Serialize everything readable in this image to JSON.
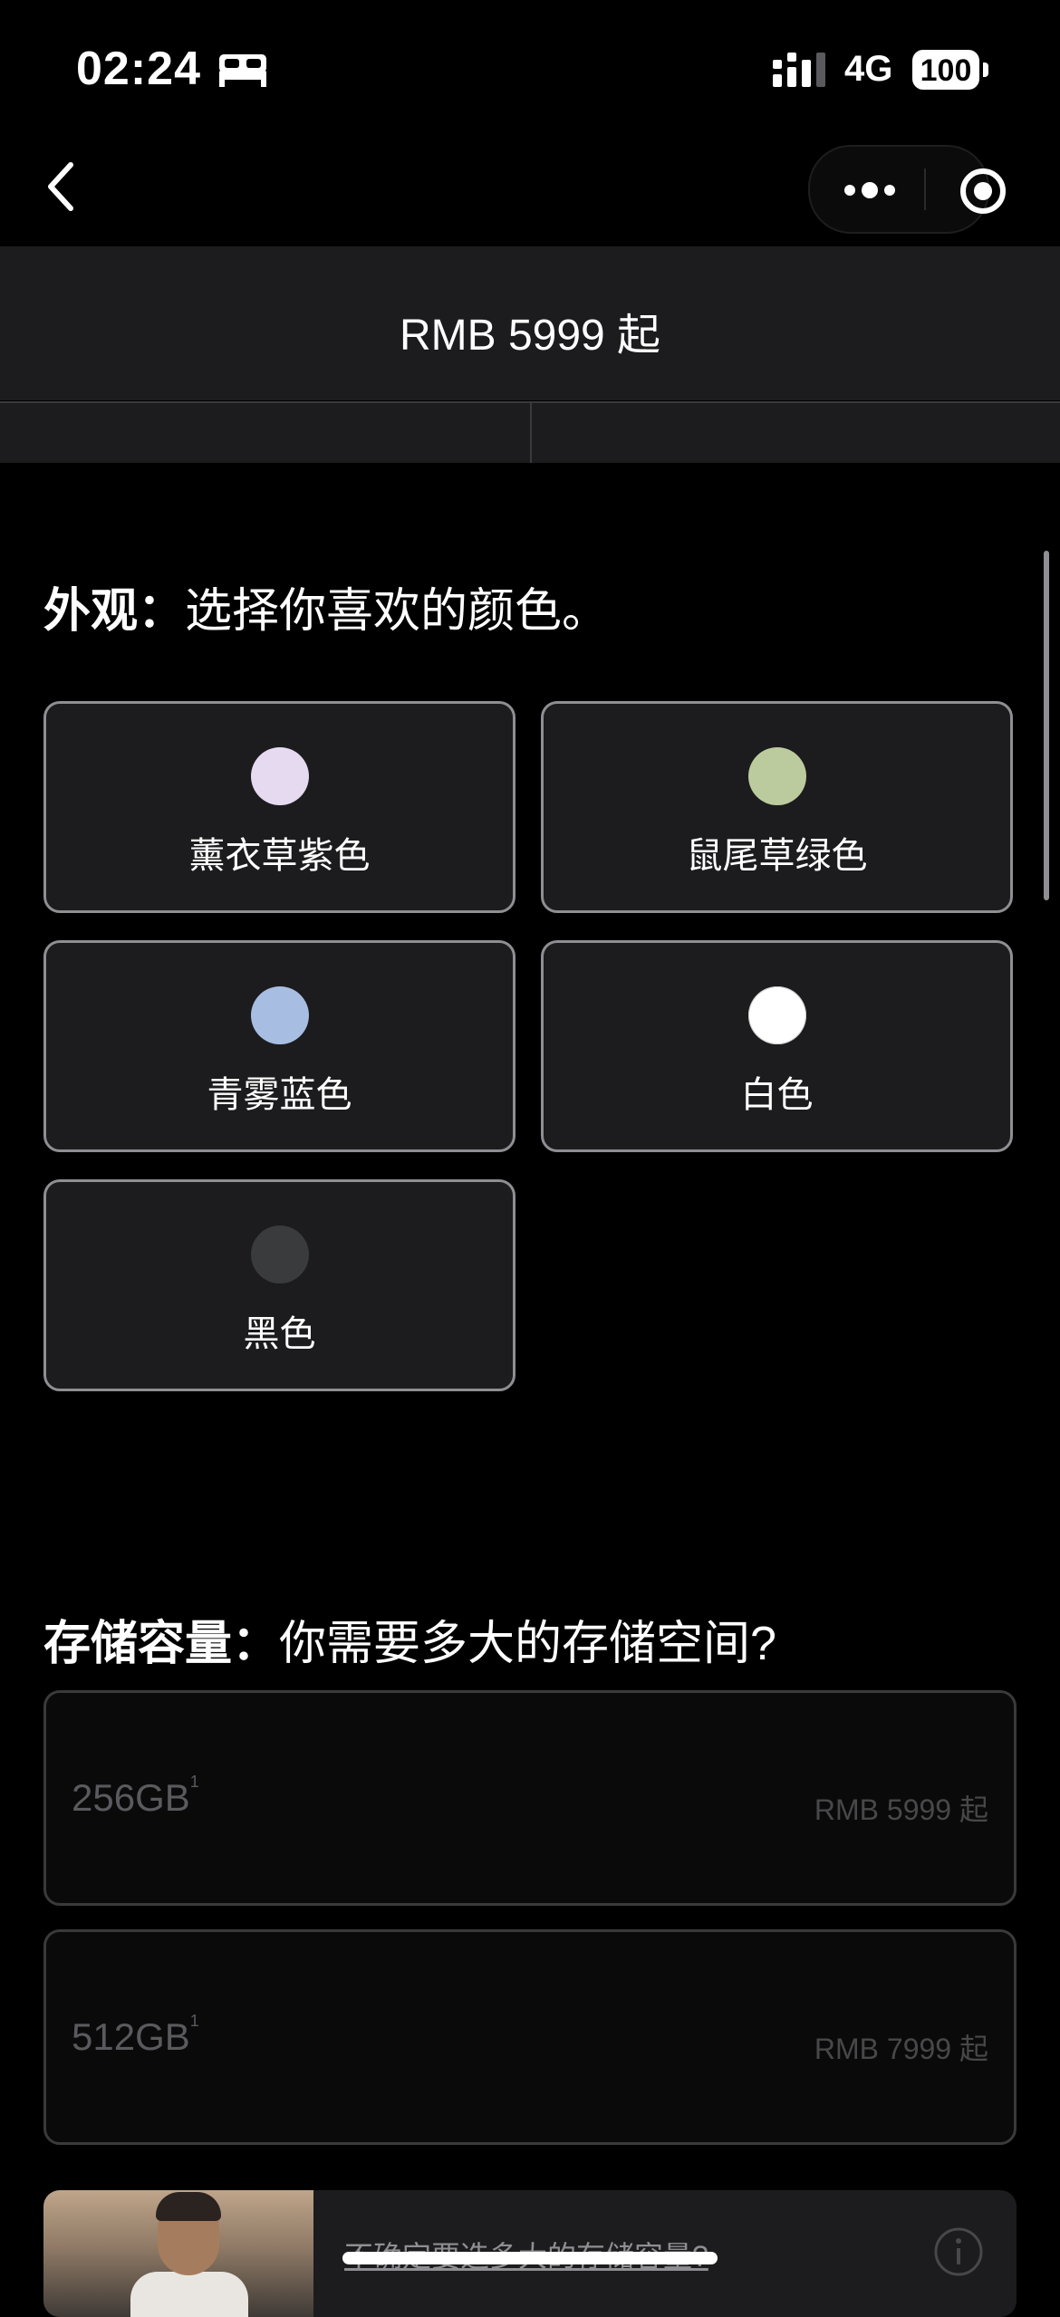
{
  "status_bar": {
    "time": "02:24",
    "network": "4G",
    "battery": "100",
    "icons": [
      "sleep-icon",
      "signal-icon",
      "battery-icon"
    ]
  },
  "nav": {
    "back_icon": "chevron-left-icon",
    "menu_icon": "more-dots-icon",
    "close_icon": "target-icon"
  },
  "header": {
    "price": "RMB 5999 起"
  },
  "color_section": {
    "title_bold": "外观：",
    "title_rest": "选择你喜欢的颜色。",
    "options": [
      {
        "label": "薰衣草紫色",
        "color": "#E6DAF0"
      },
      {
        "label": "鼠尾草绿色",
        "color": "#BCCB9E"
      },
      {
        "label": "青雾蓝色",
        "color": "#A8BDE2"
      },
      {
        "label": "白色",
        "color": "#FFFFFF"
      },
      {
        "label": "黑色",
        "color": "#3A3B3D"
      }
    ]
  },
  "storage_section": {
    "title_bold": "存储容量：",
    "title_rest": "你需要多大的存储空间?",
    "options": [
      {
        "capacity": "256GB",
        "footnote": "1",
        "price": "RMB 5999 起"
      },
      {
        "capacity": "512GB",
        "footnote": "1",
        "price": "RMB 7999 起"
      }
    ]
  },
  "help_banner": {
    "text": "不确定要选多大的存储容量?",
    "icon": "info-icon"
  },
  "colors": {
    "background": "#000000",
    "card": "#1C1C1E",
    "card_border": "#8E8E93"
  }
}
